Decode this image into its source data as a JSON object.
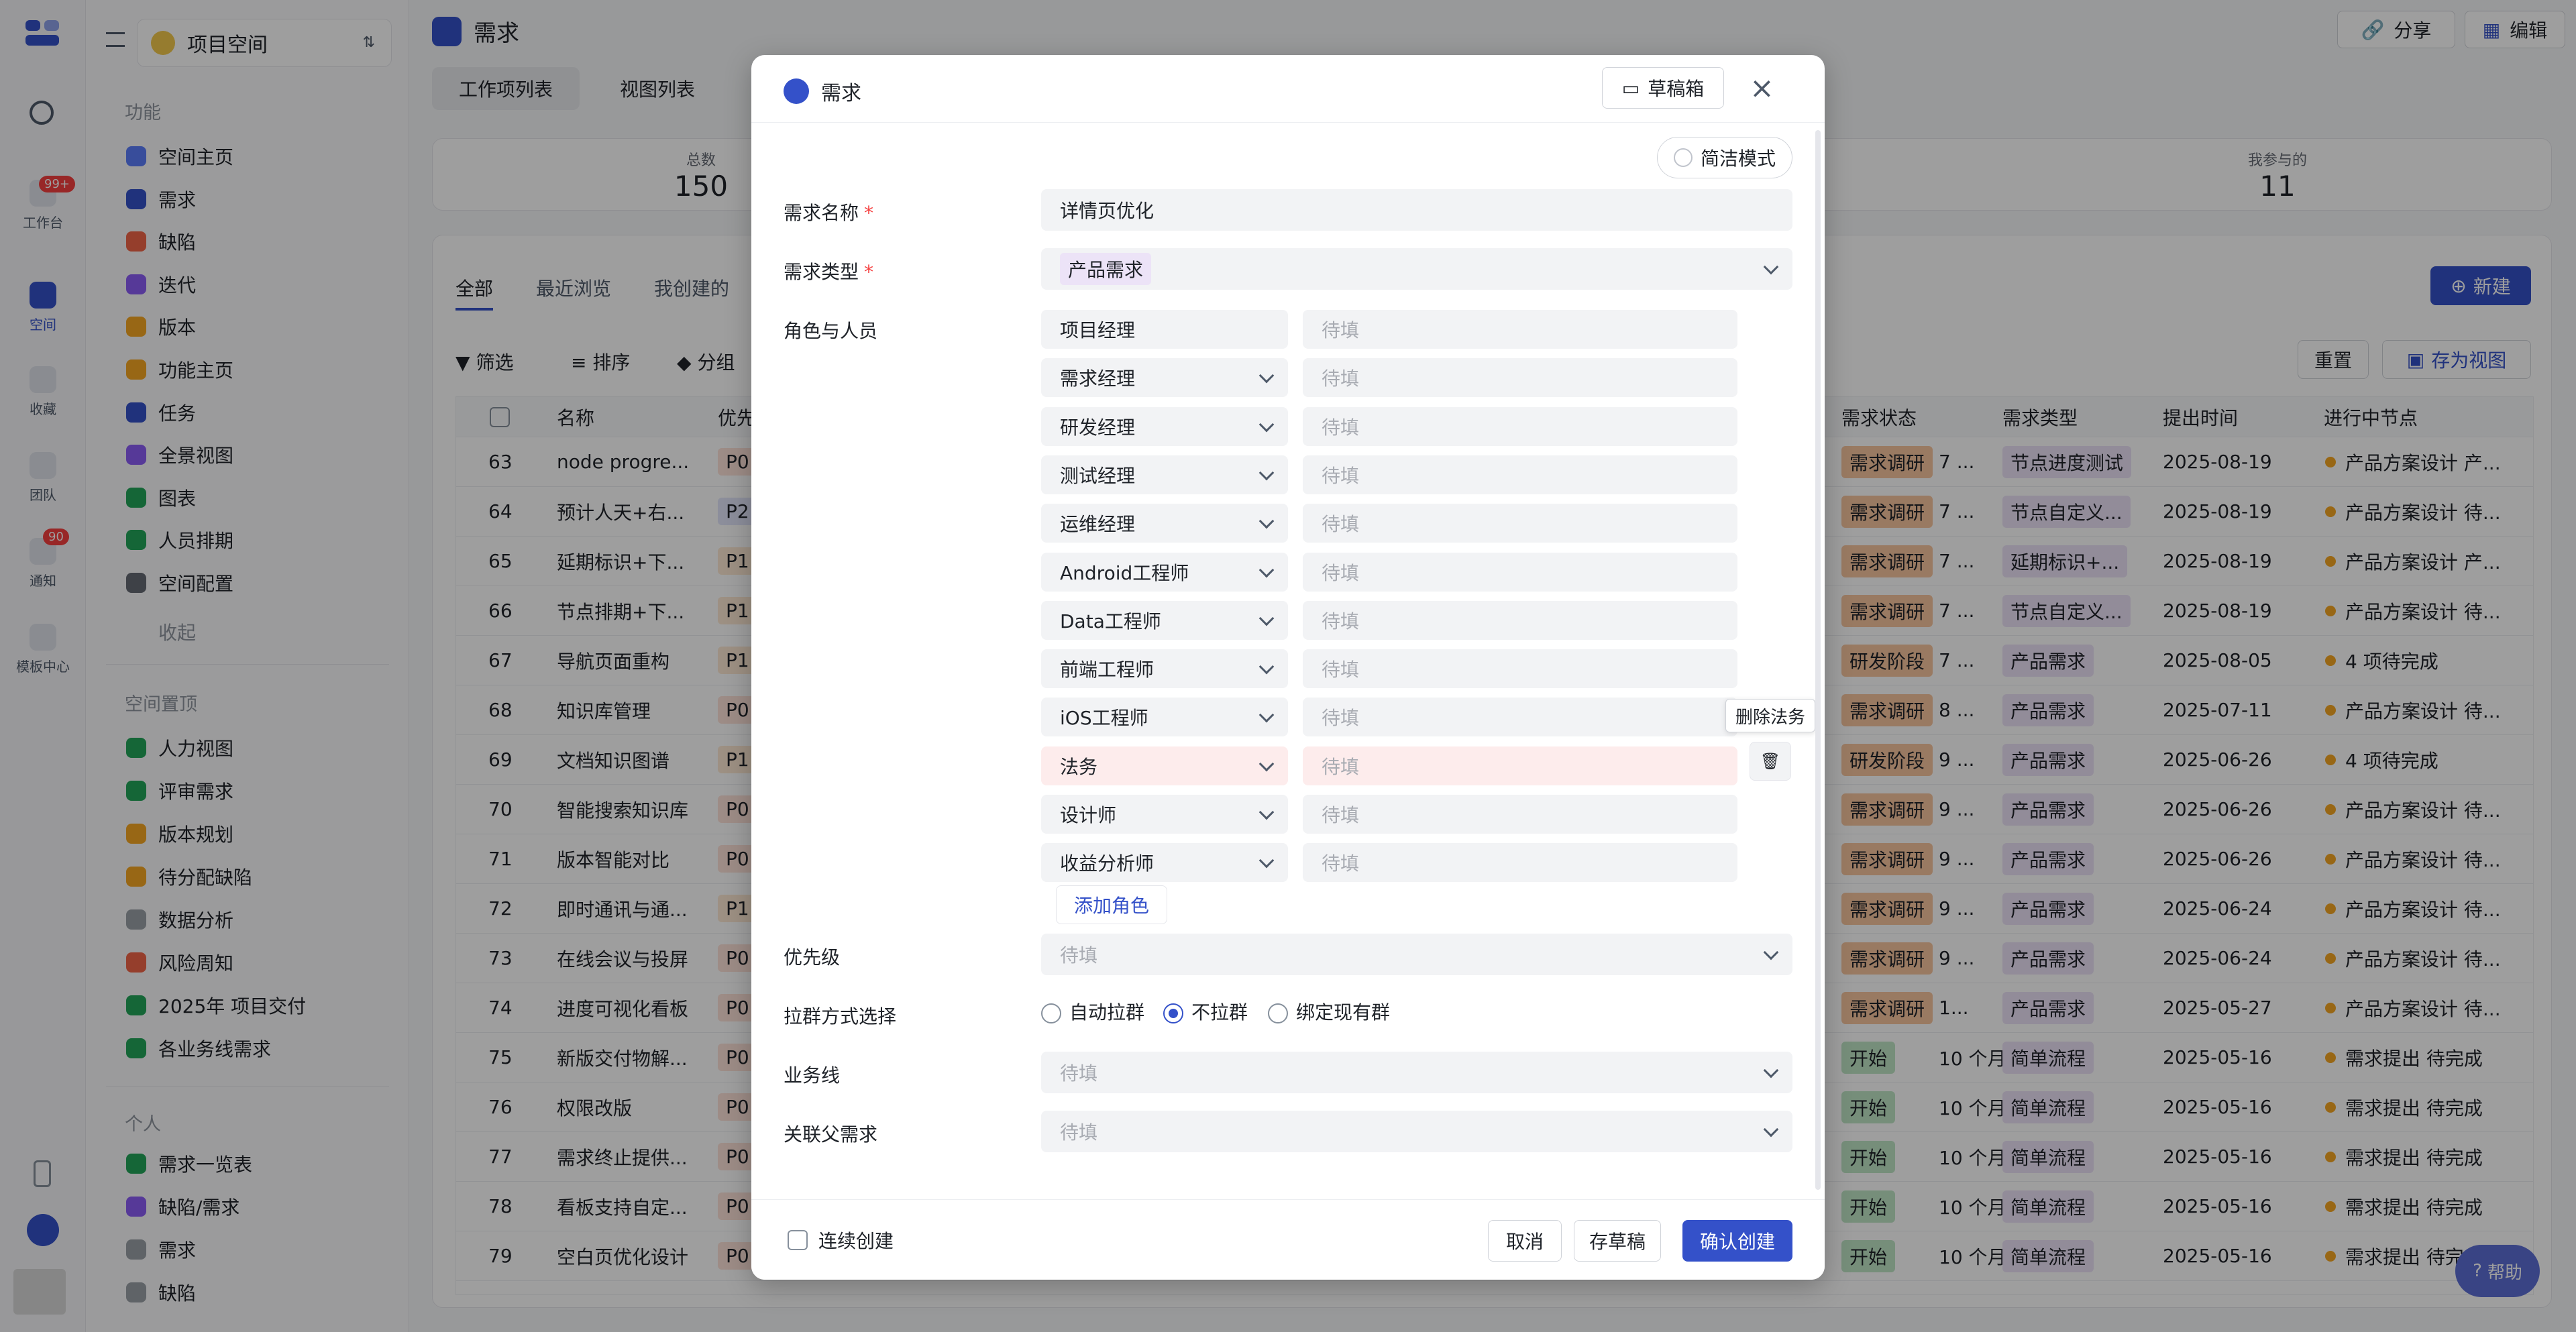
{
  "rail": {
    "items": [
      {
        "label": "工作台",
        "badge": "99+"
      },
      {
        "label": "空间"
      },
      {
        "label": "收藏"
      },
      {
        "label": "团队"
      },
      {
        "label": "通知",
        "badge": "90"
      },
      {
        "label": "模板中心"
      }
    ]
  },
  "sidebar": {
    "space_name": "项目空间",
    "section_features": "功能",
    "features": [
      "空间主页",
      "需求",
      "缺陷",
      "迭代",
      "版本",
      "功能主页",
      "任务",
      "全景视图",
      "图表",
      "人员排期",
      "空间配置"
    ],
    "collapse_label": "收起",
    "section_pinned": "空间置顶",
    "pinned": [
      "人力视图",
      "评审需求",
      "版本规划",
      "待分配缺陷",
      "数据分析",
      "风险周知",
      "2025年 项目交付",
      "各业务线需求"
    ],
    "section_personal": "个人",
    "personal": [
      "需求一览表",
      "缺陷/需求",
      "需求",
      "缺陷"
    ]
  },
  "header": {
    "title": "需求",
    "share_label": "分享",
    "edit_label": "编辑",
    "tabs": [
      "工作项列表",
      "视图列表"
    ]
  },
  "stats": [
    {
      "label": "总数",
      "value": "150"
    },
    {
      "label": "我参与的",
      "value": "11"
    }
  ],
  "list": {
    "tabs": [
      "全部",
      "最近浏览",
      "我创建的"
    ],
    "new_label": "新建",
    "filter_label": "筛选",
    "sort_label": "排序",
    "group_label": "分组",
    "reset_label": "重置",
    "save_view_label": "存为视图",
    "columns": [
      "名称",
      "优先",
      "需求状态",
      "需求类型",
      "提出时间",
      "进行中节点"
    ],
    "rows": [
      {
        "id": "63",
        "name": "node progre...",
        "pri": "P0",
        "status": "需求调研",
        "dur": "7 ...",
        "type": "节点进度测试",
        "date": "2025-08-19",
        "node": "产品方案设计 产..."
      },
      {
        "id": "64",
        "name": "预计人天+右...",
        "pri": "P2",
        "status": "需求调研",
        "dur": "7 ...",
        "type": "节点自定义...",
        "date": "2025-08-19",
        "node": "产品方案设计 待..."
      },
      {
        "id": "65",
        "name": "延期标识+下...",
        "pri": "P1",
        "status": "需求调研",
        "dur": "7 ...",
        "type": "延期标识+...",
        "date": "2025-08-19",
        "node": "产品方案设计 产..."
      },
      {
        "id": "66",
        "name": "节点排期+下...",
        "pri": "P1",
        "status": "需求调研",
        "dur": "7 ...",
        "type": "节点自定义...",
        "date": "2025-08-19",
        "node": "产品方案设计 待..."
      },
      {
        "id": "67",
        "name": "导航页面重构",
        "pri": "P1",
        "status": "研发阶段",
        "dur": "7 ...",
        "type": "产品需求",
        "date": "2025-08-05",
        "node": "4 项待完成"
      },
      {
        "id": "68",
        "name": "知识库管理",
        "pri": "P0",
        "status": "需求调研",
        "dur": "8 ...",
        "type": "产品需求",
        "date": "2025-07-11",
        "node": "产品方案设计 待..."
      },
      {
        "id": "69",
        "name": "文档知识图谱",
        "pri": "P1",
        "status": "研发阶段",
        "dur": "9 ...",
        "type": "产品需求",
        "date": "2025-06-26",
        "node": "4 项待完成"
      },
      {
        "id": "70",
        "name": "智能搜索知识库",
        "pri": "P0",
        "status": "需求调研",
        "dur": "9 ...",
        "type": "产品需求",
        "date": "2025-06-26",
        "node": "产品方案设计 待..."
      },
      {
        "id": "71",
        "name": "版本智能对比",
        "pri": "P0",
        "status": "需求调研",
        "dur": "9 ...",
        "type": "产品需求",
        "date": "2025-06-26",
        "node": "产品方案设计 待..."
      },
      {
        "id": "72",
        "name": "即时通讯与通...",
        "pri": "P1",
        "status": "需求调研",
        "dur": "9 ...",
        "type": "产品需求",
        "date": "2025-06-24",
        "node": "产品方案设计 待..."
      },
      {
        "id": "73",
        "name": "在线会议与投屏",
        "pri": "P0",
        "status": "需求调研",
        "dur": "9 ...",
        "type": "产品需求",
        "date": "2025-06-24",
        "node": "产品方案设计 待..."
      },
      {
        "id": "74",
        "name": "进度可视化看板",
        "pri": "P0",
        "status": "需求调研",
        "dur": "1...",
        "type": "产品需求",
        "date": "2025-05-27",
        "node": "产品方案设计 待..."
      },
      {
        "id": "75",
        "name": "新版交付物解...",
        "pri": "P0",
        "status": "开始",
        "dur": "10 个月",
        "type": "简单流程",
        "date": "2025-05-16",
        "node": "需求提出 待完成"
      },
      {
        "id": "76",
        "name": "权限改版",
        "pri": "P0",
        "status": "开始",
        "dur": "10 个月",
        "type": "简单流程",
        "date": "2025-05-16",
        "node": "需求提出 待完成"
      },
      {
        "id": "77",
        "name": "需求终止提供...",
        "pri": "P0",
        "status": "开始",
        "dur": "10 个月",
        "type": "简单流程",
        "date": "2025-05-16",
        "node": "需求提出 待完成"
      },
      {
        "id": "78",
        "name": "看板支持自定...",
        "pri": "P0",
        "status": "开始",
        "dur": "10 个月",
        "type": "简单流程",
        "date": "2025-05-16",
        "node": "需求提出 待完成"
      },
      {
        "id": "79",
        "name": "空白页优化设计",
        "pri": "P0",
        "status": "开始",
        "dur": "10 个月",
        "type": "简单流程",
        "date": "2025-05-16",
        "node": "需求提出 待完成"
      }
    ]
  },
  "modal": {
    "title": "需求",
    "drafts_label": "草稿箱",
    "simple_mode_label": "简洁模式",
    "name_label": "需求名称",
    "name_value": "详情页优化",
    "type_label": "需求类型",
    "type_value": "产品需求",
    "roles_label": "角色与人员",
    "placeholder": "待填",
    "roles": [
      "项目经理",
      "需求经理",
      "研发经理",
      "测试经理",
      "运维经理",
      "Android工程师",
      "Data工程师",
      "前端工程师",
      "iOS工程师",
      "法务",
      "设计师",
      "收益分析师"
    ],
    "add_role_label": "添加角色",
    "delete_tooltip": "删除法务",
    "priority_label": "优先级",
    "group_label": "拉群方式选择",
    "group_options": [
      "自动拉群",
      "不拉群",
      "绑定现有群"
    ],
    "biz_label": "业务线",
    "parent_label": "关联父需求",
    "continuous_label": "连续创建",
    "cancel_label": "取消",
    "save_draft_label": "存草稿",
    "confirm_label": "确认创建"
  },
  "help_label": "帮助",
  "colors": {
    "primary": "#3451c9",
    "danger": "#f53f3f"
  }
}
